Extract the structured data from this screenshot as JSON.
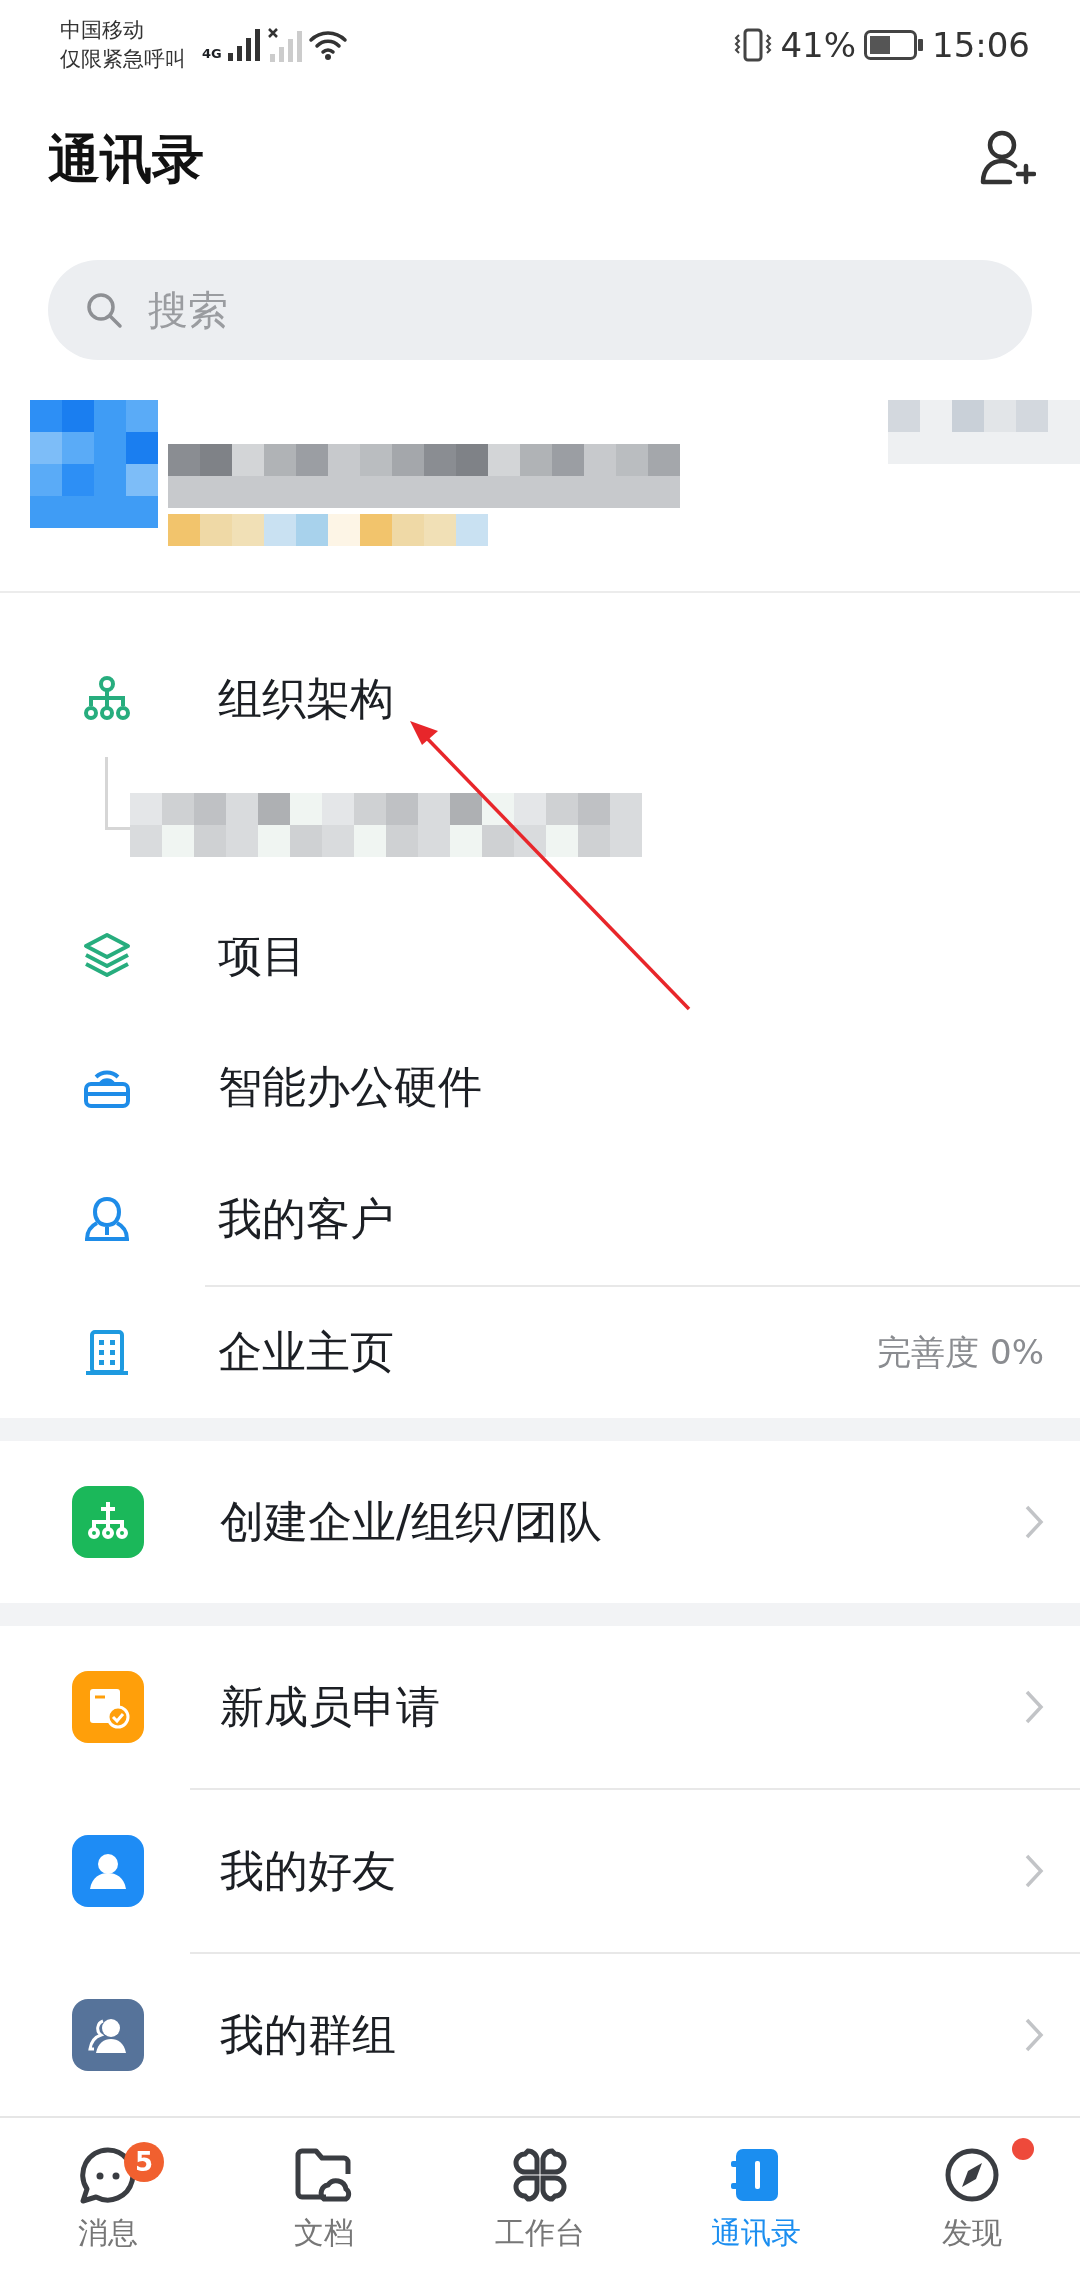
{
  "status_bar": {
    "carrier": "中国移动",
    "carrier_note": "仅限紧急呼叫",
    "network": "4G",
    "battery": "41%",
    "time": "15:06"
  },
  "header": {
    "title": "通讯录"
  },
  "search": {
    "placeholder": "搜索"
  },
  "profile_card": {
    "redacted": true
  },
  "org_section": [
    {
      "kind": "org",
      "label": "组织架构",
      "redacted_child": true
    },
    {
      "kind": "plain",
      "label": "项目"
    },
    {
      "kind": "plain",
      "label": "智能办公硬件"
    },
    {
      "kind": "plain",
      "label": "我的客户"
    },
    {
      "kind": "plain",
      "label": "企业主页",
      "note": "完善度 0%"
    }
  ],
  "create_section": [
    {
      "label": "创建企业/组织/团队",
      "color": "#1bb85a"
    }
  ],
  "contact_section": [
    {
      "label": "新成员申请",
      "color": "#ff9f0a"
    },
    {
      "label": "我的好友",
      "color": "#1e8cf5"
    },
    {
      "label": "我的群组",
      "color": "#56739a"
    }
  ],
  "annotation": {
    "kind": "arrow"
  },
  "tab_bar": [
    {
      "label": "消息",
      "selected": false,
      "badge": "5",
      "dot": false
    },
    {
      "label": "文档",
      "selected": false,
      "dot": false
    },
    {
      "label": "工作台",
      "selected": false,
      "dot": false
    },
    {
      "label": "通讯录",
      "selected": true,
      "dot": false
    },
    {
      "label": "发现",
      "selected": false,
      "dot": true
    }
  ]
}
